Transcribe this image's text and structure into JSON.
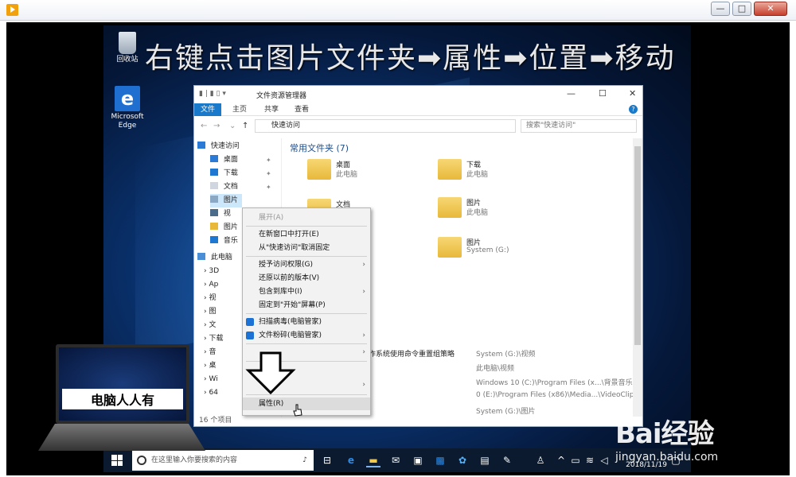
{
  "player": {
    "window_controls": [
      "—",
      "□",
      "✕"
    ]
  },
  "caption": "右键点击图片文件夹➡属性➡位置➡移动",
  "desktop_icons": [
    {
      "label": "回收站"
    },
    {
      "label": "Microsoft Edge"
    }
  ],
  "explorer": {
    "title": "文件资源管理器",
    "quick_access_toolbar": "▮ | ▮ ▯ ▾",
    "controls": {
      "minimize": "—",
      "maximize": "☐",
      "close": "✕"
    },
    "ribbon_tabs": [
      "文件",
      "主页",
      "共享",
      "查看"
    ],
    "address": "快速访问",
    "search_placeholder": "搜索\"快速访问\"",
    "nav": {
      "quick_access": "快速访问",
      "items": [
        "桌面",
        "下载",
        "文档",
        "图片",
        "视",
        "图片",
        "音乐"
      ],
      "this_pc": "此电脑",
      "pc_items": [
        "3D",
        "Ap",
        "视",
        "图",
        "文",
        "下载",
        "音",
        "桌",
        "Wi",
        "64"
      ]
    },
    "group_title": "常用文件夹 (7)",
    "folders": [
      {
        "name": "桌面",
        "sub": "此电脑"
      },
      {
        "name": "下载",
        "sub": "此电脑"
      },
      {
        "name": "文档",
        "sub": ""
      },
      {
        "name": "图片",
        "sub": "此电脑"
      },
      {
        "name": "",
        "sub": ""
      },
      {
        "name": "图片",
        "sub": "System (G:)"
      }
    ],
    "recent_title": "操作系统使用命令重置组策略",
    "recent_paths": [
      "System (G:)\\视频",
      "此电脑\\视频",
      "Windows 10 (C:)\\Program Files (x...\\背景音乐",
      "0 (E:)\\Program Files (x86)\\Media...\\VideoClip",
      "System (G:)\\图片"
    ],
    "status": "16 个项目"
  },
  "context_menu": {
    "items": [
      {
        "label": "展开(A)",
        "disabled": true
      },
      {
        "label": "在新窗口中打开(E)"
      },
      {
        "label": "从\"快速访问\"取消固定"
      },
      {
        "label": "授予访问权限(G)",
        "submenu": true
      },
      {
        "label": "还原以前的版本(V)"
      },
      {
        "label": "包含到库中(I)",
        "submenu": true
      },
      {
        "label": "固定到\"开始\"屏幕(P)"
      },
      {
        "label": "扫描病毒(电脑管家)",
        "icon": "shield-icon"
      },
      {
        "label": "文件粉碎(电脑管家)",
        "icon": "shield-icon",
        "submenu": true
      },
      {
        "label": "",
        "submenu": true
      },
      {
        "label": "",
        "submenu": true
      },
      {
        "label": "属性(R)",
        "highlighted": true
      }
    ]
  },
  "logo_text": "电脑人人有",
  "taskbar": {
    "search_placeholder": "在这里输入你要搜索的内容",
    "date": "2018/11/19"
  },
  "watermark": {
    "main": "Bai经验",
    "sub": "jingyan.baidu.com"
  }
}
